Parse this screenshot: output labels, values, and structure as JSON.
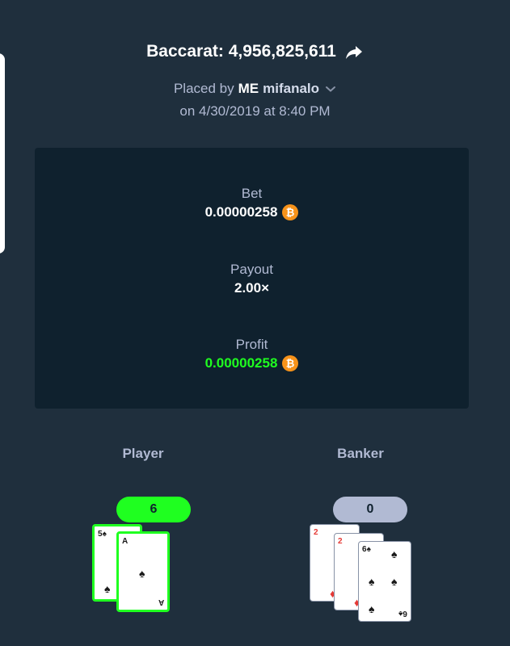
{
  "header": {
    "game_title": "Baccarat: 4,956,825,611",
    "placed_by_prefix": "Placed by",
    "user_tag": "ME",
    "username": "mifanalo",
    "date_line": "on 4/30/2019 at 8:40 PM"
  },
  "stats": {
    "bet_label": "Bet",
    "bet_value": "0.00000258",
    "payout_label": "Payout",
    "payout_value": "2.00×",
    "profit_label": "Profit",
    "profit_value": "0.00000258"
  },
  "hands": {
    "player": {
      "label": "Player",
      "score": "6",
      "cards": [
        {
          "rank": "5",
          "suit": "♠"
        },
        {
          "rank": "A",
          "suit": "♠"
        }
      ]
    },
    "banker": {
      "label": "Banker",
      "score": "0",
      "cards": [
        {
          "rank": "2",
          "suit": "♦"
        },
        {
          "rank": "2",
          "suit": "♦"
        },
        {
          "rank": "6",
          "suit": "♠"
        }
      ]
    }
  },
  "colors": {
    "background": "#1f2f3d",
    "panel": "#0f212e",
    "win_green": "#1fff20",
    "muted_text": "#b1bad3",
    "btc_orange": "#f7931a"
  },
  "icons": {
    "share": "share-arrow-icon",
    "dropdown": "chevron-down-icon",
    "currency": "bitcoin-icon"
  }
}
